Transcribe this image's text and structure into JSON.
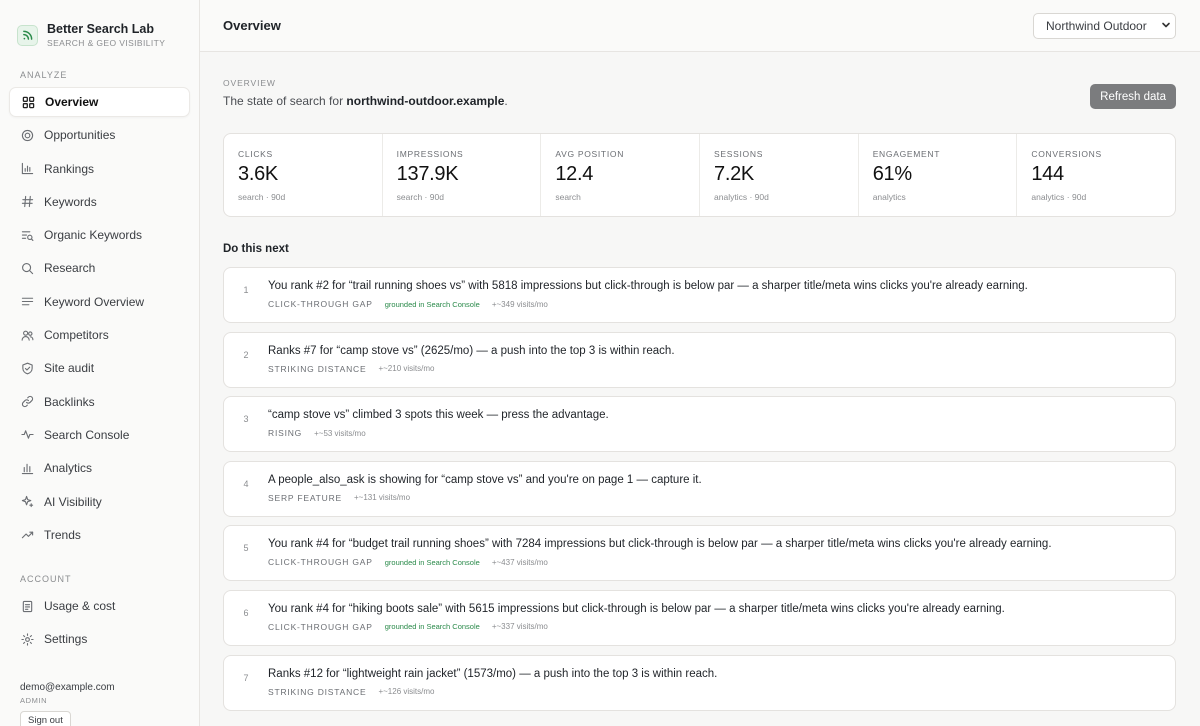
{
  "brand": {
    "name": "Better Search Lab",
    "subtitle": "SEARCH & GEO VISIBILITY"
  },
  "sidebar": {
    "analyze_label": "ANALYZE",
    "analyze_items": [
      {
        "label": "Overview",
        "icon": "grid-icon",
        "active": true
      },
      {
        "label": "Opportunities",
        "icon": "target-icon"
      },
      {
        "label": "Rankings",
        "icon": "bar-chart-icon"
      },
      {
        "label": "Keywords",
        "icon": "hash-icon"
      },
      {
        "label": "Organic Keywords",
        "icon": "list-search-icon"
      },
      {
        "label": "Research",
        "icon": "search-icon"
      },
      {
        "label": "Keyword Overview",
        "icon": "lines-icon"
      },
      {
        "label": "Competitors",
        "icon": "users-icon"
      },
      {
        "label": "Site audit",
        "icon": "shield-icon"
      },
      {
        "label": "Backlinks",
        "icon": "link-icon"
      },
      {
        "label": "Search Console",
        "icon": "pulse-icon"
      },
      {
        "label": "Analytics",
        "icon": "column-chart-icon"
      },
      {
        "label": "AI Visibility",
        "icon": "sparkle-icon"
      },
      {
        "label": "Trends",
        "icon": "trend-up-icon"
      }
    ],
    "account_label": "ACCOUNT",
    "account_items": [
      {
        "label": "Usage & cost",
        "icon": "document-icon"
      },
      {
        "label": "Settings",
        "icon": "gear-icon"
      }
    ],
    "user": {
      "email": "demo@example.com",
      "role": "ADMIN",
      "signout": "Sign out"
    }
  },
  "header": {
    "title": "Overview",
    "site_select": "Northwind Outdoor"
  },
  "overview": {
    "eyebrow": "OVERVIEW",
    "subtitle_prefix": "The state of search for ",
    "domain": "northwind-outdoor.example",
    "subtitle_suffix": ".",
    "refresh_label": "Refresh data"
  },
  "stats": [
    {
      "label": "CLICKS",
      "value": "3.6K",
      "note": "search · 90d"
    },
    {
      "label": "IMPRESSIONS",
      "value": "137.9K",
      "note": "search · 90d"
    },
    {
      "label": "AVG POSITION",
      "value": "12.4",
      "note": "search"
    },
    {
      "label": "SESSIONS",
      "value": "7.2K",
      "note": "analytics · 90d"
    },
    {
      "label": "ENGAGEMENT",
      "value": "61%",
      "note": "analytics"
    },
    {
      "label": "CONVERSIONS",
      "value": "144",
      "note": "analytics · 90d"
    }
  ],
  "do_next": {
    "heading": "Do this next",
    "items": [
      {
        "num": "1",
        "text": "You rank #2 for “trail running shoes vs” with 5818 impressions but click-through is below par — a sharper title/meta wins clicks you're already earning.",
        "tag": "CLICK-THROUGH GAP",
        "grounded": "grounded in Search Console",
        "visits": "+~349 visits/mo"
      },
      {
        "num": "2",
        "text": "Ranks #7 for “camp stove vs” (2625/mo) — a push into the top 3 is within reach.",
        "tag": "STRIKING DISTANCE",
        "grounded": "",
        "visits": "+~210 visits/mo"
      },
      {
        "num": "3",
        "text": "“camp stove vs” climbed 3 spots this week — press the advantage.",
        "tag": "RISING",
        "grounded": "",
        "visits": "+~53 visits/mo"
      },
      {
        "num": "4",
        "text": "A people_also_ask is showing for “camp stove vs” and you're on page 1 — capture it.",
        "tag": "SERP FEATURE",
        "grounded": "",
        "visits": "+~131 visits/mo"
      },
      {
        "num": "5",
        "text": "You rank #4 for “budget trail running shoes” with 7284 impressions but click-through is below par — a sharper title/meta wins clicks you're already earning.",
        "tag": "CLICK-THROUGH GAP",
        "grounded": "grounded in Search Console",
        "visits": "+~437 visits/mo"
      },
      {
        "num": "6",
        "text": "You rank #4 for “hiking boots sale” with 5615 impressions but click-through is below par — a sharper title/meta wins clicks you're already earning.",
        "tag": "CLICK-THROUGH GAP",
        "grounded": "grounded in Search Console",
        "visits": "+~337 visits/mo"
      },
      {
        "num": "7",
        "text": "Ranks #12 for “lightweight rain jacket” (1573/mo) — a push into the top 3 is within reach.",
        "tag": "STRIKING DISTANCE",
        "grounded": "",
        "visits": "+~126 visits/mo"
      }
    ]
  },
  "colors": {
    "accent_green": "#2a8a4a",
    "refresh_button": "#7b7c7e"
  }
}
